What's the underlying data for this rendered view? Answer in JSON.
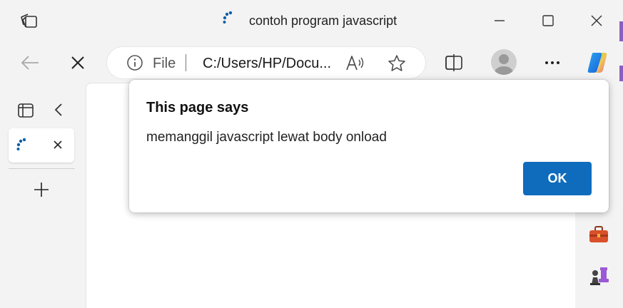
{
  "window": {
    "title": "contoh program javascript",
    "icons": {
      "workspaces": "workspaces-icon",
      "tab_favicon": "loading-spinner-icon",
      "minimize": "minimize-icon",
      "maximize": "maximize-icon",
      "close": "close-icon"
    }
  },
  "navbar": {
    "back_icon": "back-arrow-icon",
    "stop_icon": "stop-loading-icon",
    "address": {
      "info_icon": "info-icon",
      "scheme_label": "File",
      "url": "C:/Users/HP/Docu...",
      "read_aloud_icon": "read-aloud-icon",
      "favorite_icon": "star-icon"
    },
    "split_screen_icon": "split-screen-icon",
    "profile_icon": "avatar",
    "more_icon": "more-dots-icon",
    "copilot_icon": "copilot-icon"
  },
  "sidebar": {
    "tab_actions_icon": "tab-actions-icon",
    "collapse_icon": "chevron-left-icon",
    "tabs": [
      {
        "favicon": "loading-spinner-icon",
        "close_icon": "close-icon"
      }
    ],
    "new_tab_icon": "plus-icon"
  },
  "rightbar": {
    "tools_icon": "toolbox-icon",
    "games_icon": "chess-games-icon"
  },
  "dialog": {
    "title": "This page says",
    "message": "memanggil javascript lewat body onload",
    "ok_label": "OK"
  },
  "colors": {
    "accent": "#0f6cbd",
    "chrome_bg": "#f3f3f3",
    "purple_edge": "#8b5fbf"
  }
}
